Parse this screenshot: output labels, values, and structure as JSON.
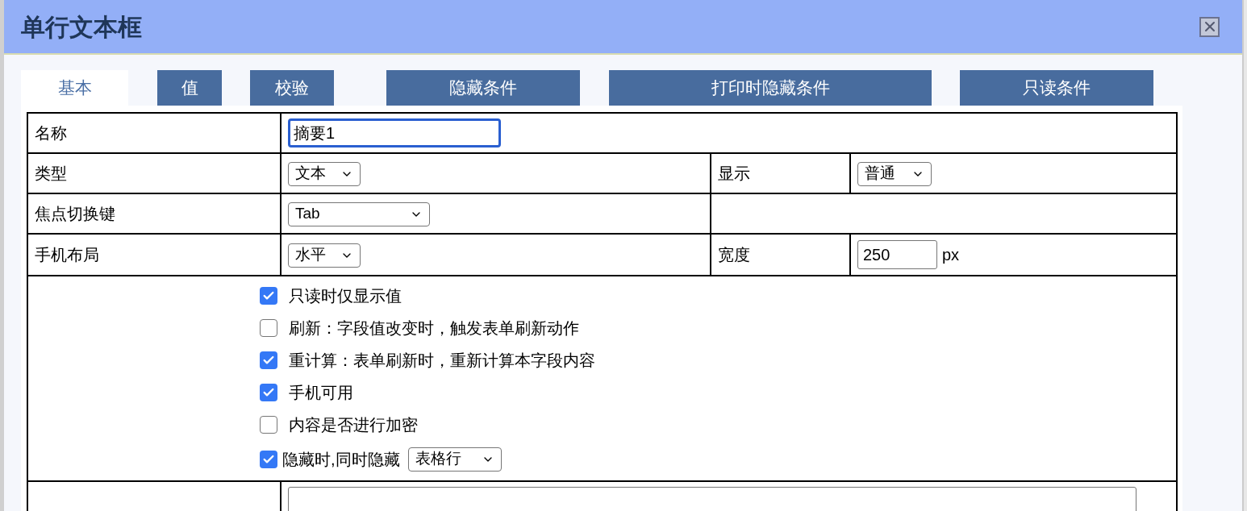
{
  "window": {
    "title": "单行文本框"
  },
  "tabs": [
    {
      "label": "基本",
      "selected": true
    },
    {
      "label": "值",
      "selected": false
    },
    {
      "label": "校验",
      "selected": false
    },
    {
      "label": "隐藏条件",
      "selected": false
    },
    {
      "label": "打印时隐藏条件",
      "selected": false
    },
    {
      "label": "只读条件",
      "selected": false
    }
  ],
  "form": {
    "name": {
      "label": "名称",
      "value": "摘要1"
    },
    "type": {
      "label": "类型",
      "value": "文本"
    },
    "display": {
      "label": "显示",
      "value": "普通"
    },
    "focus_key": {
      "label": "焦点切换键",
      "value": "Tab"
    },
    "mobile_layout": {
      "label": "手机布局",
      "value": "水平"
    },
    "width": {
      "label": "宽度",
      "value": "250",
      "unit": "px"
    }
  },
  "options": [
    {
      "kind": "checkbox",
      "label": "只读时仅显示值",
      "checked": true
    },
    {
      "kind": "checkbox",
      "label": "刷新：字段值改变时，触发表单刷新动作",
      "checked": false
    },
    {
      "kind": "checkbox",
      "label": "重计算：表单刷新时，重新计算本字段内容",
      "checked": true
    },
    {
      "kind": "checkbox",
      "label": "手机可用",
      "checked": true
    },
    {
      "kind": "checkbox",
      "label": "内容是否进行加密",
      "checked": false
    },
    {
      "kind": "checkbox_select",
      "label": "隐藏时,同时隐藏",
      "checked": true,
      "select": "表格行"
    }
  ]
}
